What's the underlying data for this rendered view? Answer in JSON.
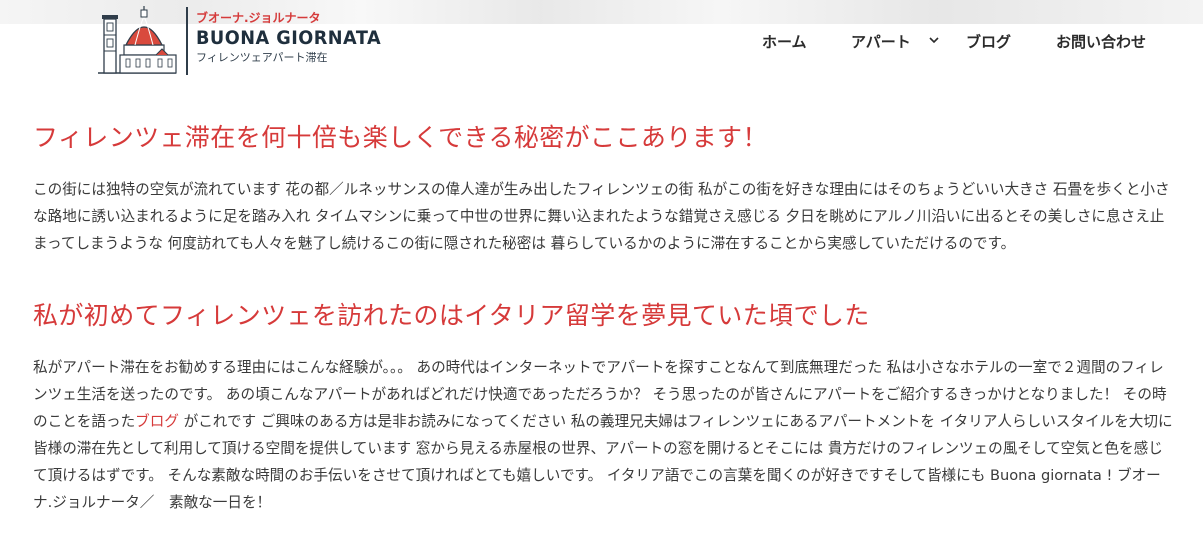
{
  "header": {
    "logo": {
      "kana": "ブオーナ.ジョルナータ",
      "name": "BUONA GIORNATA",
      "sub": "フィレンツェアパート滞在"
    },
    "nav": {
      "home": "ホーム",
      "apart": "アパート",
      "blog": "ブログ",
      "contact": "お問い合わせ"
    }
  },
  "main": {
    "section1": {
      "heading": "フィレンツェ滞在を何十倍も楽しくできる秘密がここあります！",
      "body": "この街には独特の空気が流れています 花の都／ルネッサンスの偉人達が生み出したフィレンツェの街 私がこの街を好きな理由にはそのちょうどいい大きさ 石畳を歩くと小さな路地に誘い込まれるように足を踏み入れ タイムマシンに乗って中世の世界に舞い込まれたような錯覚さえ感じる 夕日を眺めにアルノ川沿いに出るとその美しさに息さえ止まってしまうような 何度訪れても人々を魅了し続けるこの街に隠された秘密は 暮らしているかのように滞在することから実感していただけるのです。"
    },
    "section2": {
      "heading": "私が初めてフィレンツェを訪れたのはイタリア留学を夢見ていた頃でした",
      "body_before_link": "私がアパート滞在をお勧めする理由にはこんな経験が。。。 あの時代はインターネットでアパートを探すことなんて到底無理だった 私は小さなホテルの一室で２週間のフィレンツェ生活を送ったのです。 あの頃こんなアパートがあればどれだけ快適であっただろうか？ そう思ったのが皆さんにアパートをご紹介するきっかけとなりました！ その時のことを語った",
      "link": "ブログ",
      "body_after_link": " がこれです ご興味のある方は是非お読みになってください 私の義理兄夫婦はフィレンツェにあるアパートメントを イタリア人らしいスタイルを大切に皆様の滞在先として利用して頂ける空間を提供しています 窓から見える赤屋根の世界、アパートの窓を開けるとそこには 貴方だけのフィレンツェの風そして空気と色を感じて頂けるはずです。 そんな素敵な時間のお手伝いをさせて頂ければとても嬉しいです。 イタリア語でこの言葉を聞くのが好きですそして皆様にも Buona giornata ! ブオーナ.ジョルナータ／　素敵な一日を！"
    }
  },
  "colors": {
    "accent": "#d63a3a",
    "navy": "#1f2f3d",
    "text": "#3a3a3a"
  },
  "icons": {
    "logo": "florence-duomo-icon",
    "nav_dropdown": "chevron-down-icon"
  }
}
